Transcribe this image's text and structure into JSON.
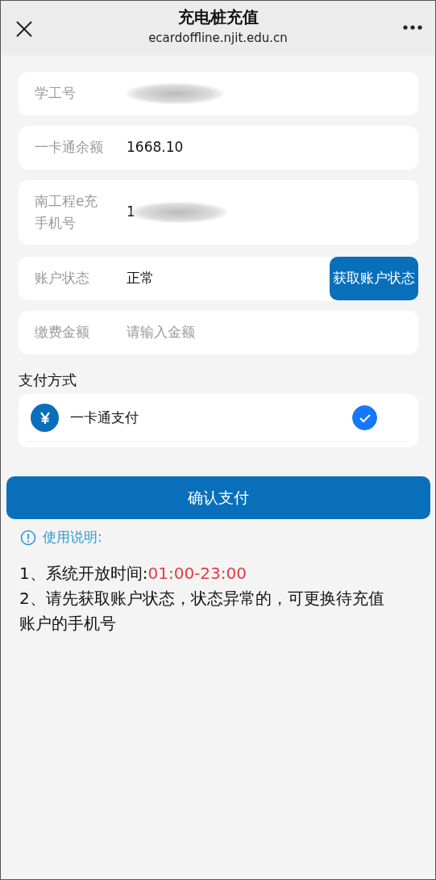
{
  "header": {
    "title": "充电桩充值",
    "subtitle": "ecardoffline.njit.edu.cn"
  },
  "rows": [
    {
      "kind": "text",
      "label": "学工号",
      "redacted": true
    },
    {
      "kind": "text",
      "label": "一卡通余额",
      "value": "1668.10"
    },
    {
      "kind": "text",
      "label": "南工程e充手机号",
      "value": "1",
      "redacted": true
    },
    {
      "kind": "status",
      "label": "账户状态",
      "value": "正常",
      "button": "获取账户状态"
    },
    {
      "kind": "field",
      "label": "缴费金额",
      "placeholder": "请输入金额"
    }
  ],
  "payment": {
    "heading": "支付方式",
    "methods": [
      {
        "label": "一卡通支付",
        "selected": true
      }
    ]
  },
  "confirm_button": "确认支付",
  "notes": {
    "heading": "使用说明:",
    "items": [
      {
        "text": "1、系统开放时间:",
        "highlight": "01:00-23:00"
      },
      {
        "text": "2、请先获取账户状态，状态异常的，可更换待充值账户的手机号"
      }
    ]
  }
}
